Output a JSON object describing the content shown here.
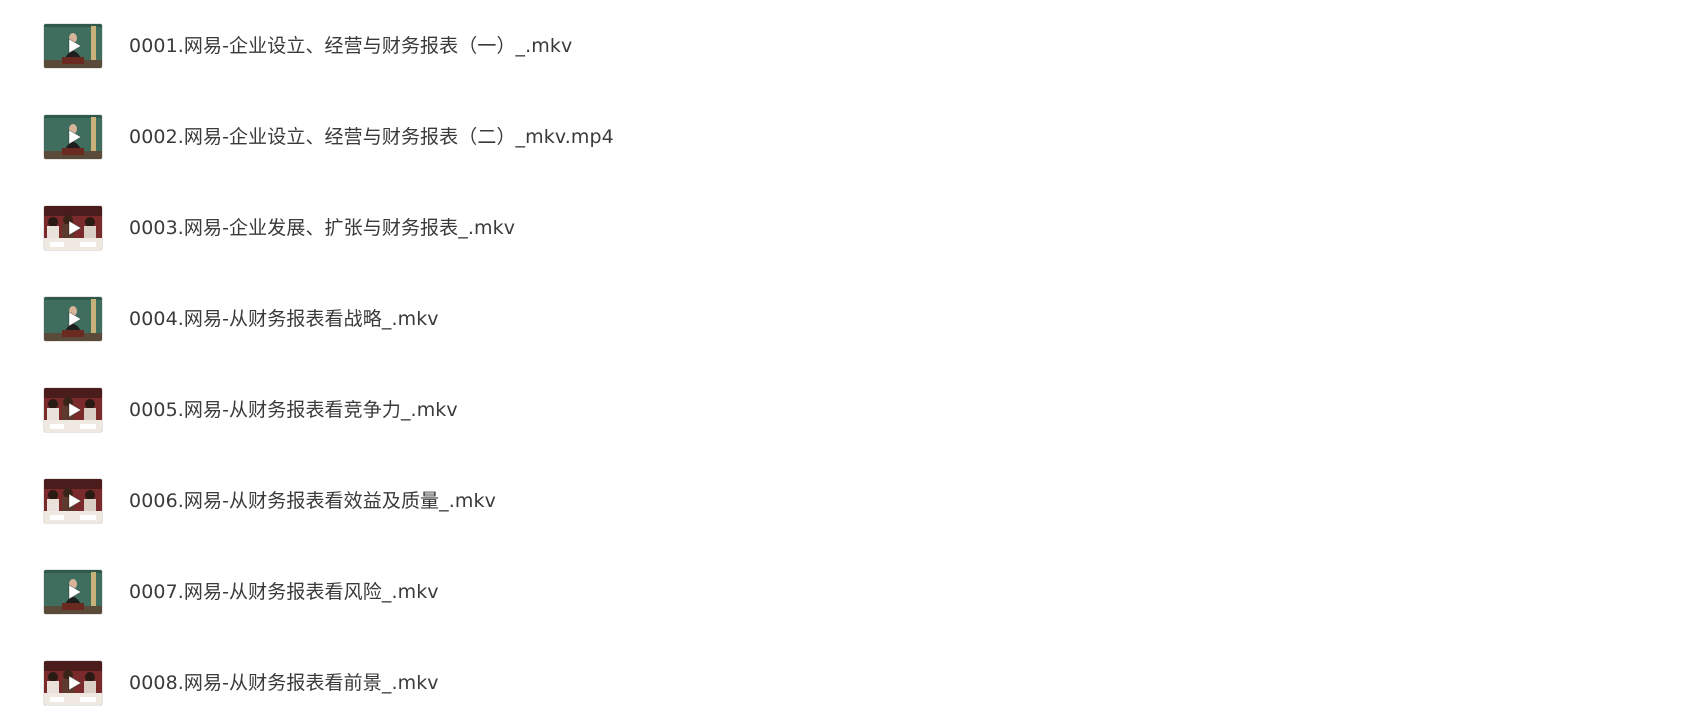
{
  "files": [
    {
      "name": "0001.网易-企业设立、经营与财务报表（一）_.mkv",
      "thumbnail": "lecturer-blackboard",
      "icon": "play-icon"
    },
    {
      "name": "0002.网易-企业设立、经营与财务报表（二）_mkv.mp4",
      "thumbnail": "lecturer-blackboard",
      "icon": "play-icon"
    },
    {
      "name": "0003.网易-企业发展、扩张与财务报表_.mkv",
      "thumbnail": "classroom-audience",
      "icon": "play-icon"
    },
    {
      "name": "0004.网易-从财务报表看战略_.mkv",
      "thumbnail": "lecturer-blackboard",
      "icon": "play-icon"
    },
    {
      "name": "0005.网易-从财务报表看竞争力_.mkv",
      "thumbnail": "classroom-audience",
      "icon": "play-icon"
    },
    {
      "name": "0006.网易-从财务报表看效益及质量_.mkv",
      "thumbnail": "classroom-audience",
      "icon": "play-icon"
    },
    {
      "name": "0007.网易-从财务报表看风险_.mkv",
      "thumbnail": "lecturer-blackboard",
      "icon": "play-icon"
    },
    {
      "name": "0008.网易-从财务报表看前景_.mkv",
      "thumbnail": "classroom-audience",
      "icon": "play-icon"
    }
  ],
  "colors": {
    "text": "#3a3a3a",
    "blackboard": "#3f6e5e",
    "classroom": "#7a2a2a",
    "play": "#ffffff"
  }
}
